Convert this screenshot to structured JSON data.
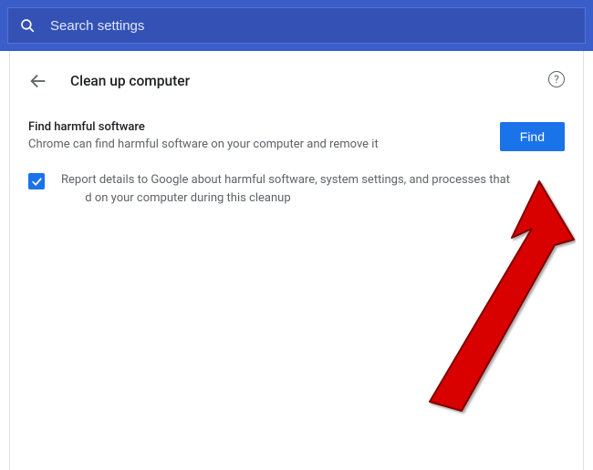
{
  "header": {
    "search_placeholder": "Search settings"
  },
  "page": {
    "title": "Clean up computer"
  },
  "section": {
    "title": "Find harmful software",
    "description": "Chrome can find harmful software on your computer and remove it",
    "find_label": "Find"
  },
  "checkbox": {
    "checked": true,
    "label_before": "Report details to Google about harmful software, system settings, and processes that",
    "label_after": "d on your computer during this cleanup"
  },
  "annotation": {
    "arrow_target": "find-button",
    "color": "#d90000"
  }
}
